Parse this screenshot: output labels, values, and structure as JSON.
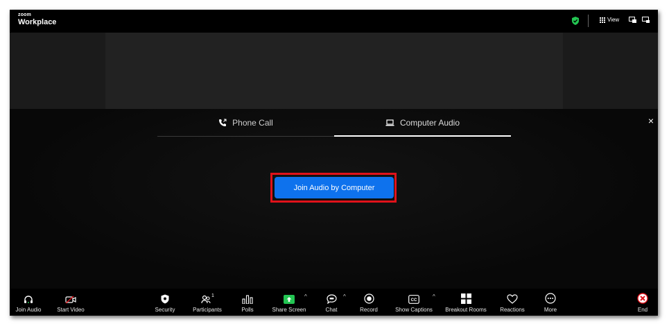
{
  "app": {
    "logo_small": "zoom",
    "logo_main": "Workplace"
  },
  "header": {
    "view_label": "View",
    "shield_color": "#23c552"
  },
  "audio_dialog": {
    "tabs": [
      {
        "label": "Phone Call",
        "icon": "phone-icon",
        "active": false
      },
      {
        "label": "Computer Audio",
        "icon": "laptop-icon",
        "active": true
      }
    ],
    "join_button_label": "Join Audio by Computer",
    "close_symbol": "×",
    "accent_color": "#0e72ed",
    "highlight_color": "#e0121a"
  },
  "toolbar": {
    "join_audio": "Join Audio",
    "start_video": "Start Video",
    "security": "Security",
    "participants": "Participants",
    "participants_count": "1",
    "polls": "Polls",
    "share_screen": "Share Screen",
    "chat": "Chat",
    "record": "Record",
    "show_captions": "Show Captions",
    "breakout_rooms": "Breakout Rooms",
    "reactions": "Reactions",
    "more": "More",
    "end": "End",
    "share_color": "#23c552",
    "end_color": "#e0121a"
  }
}
